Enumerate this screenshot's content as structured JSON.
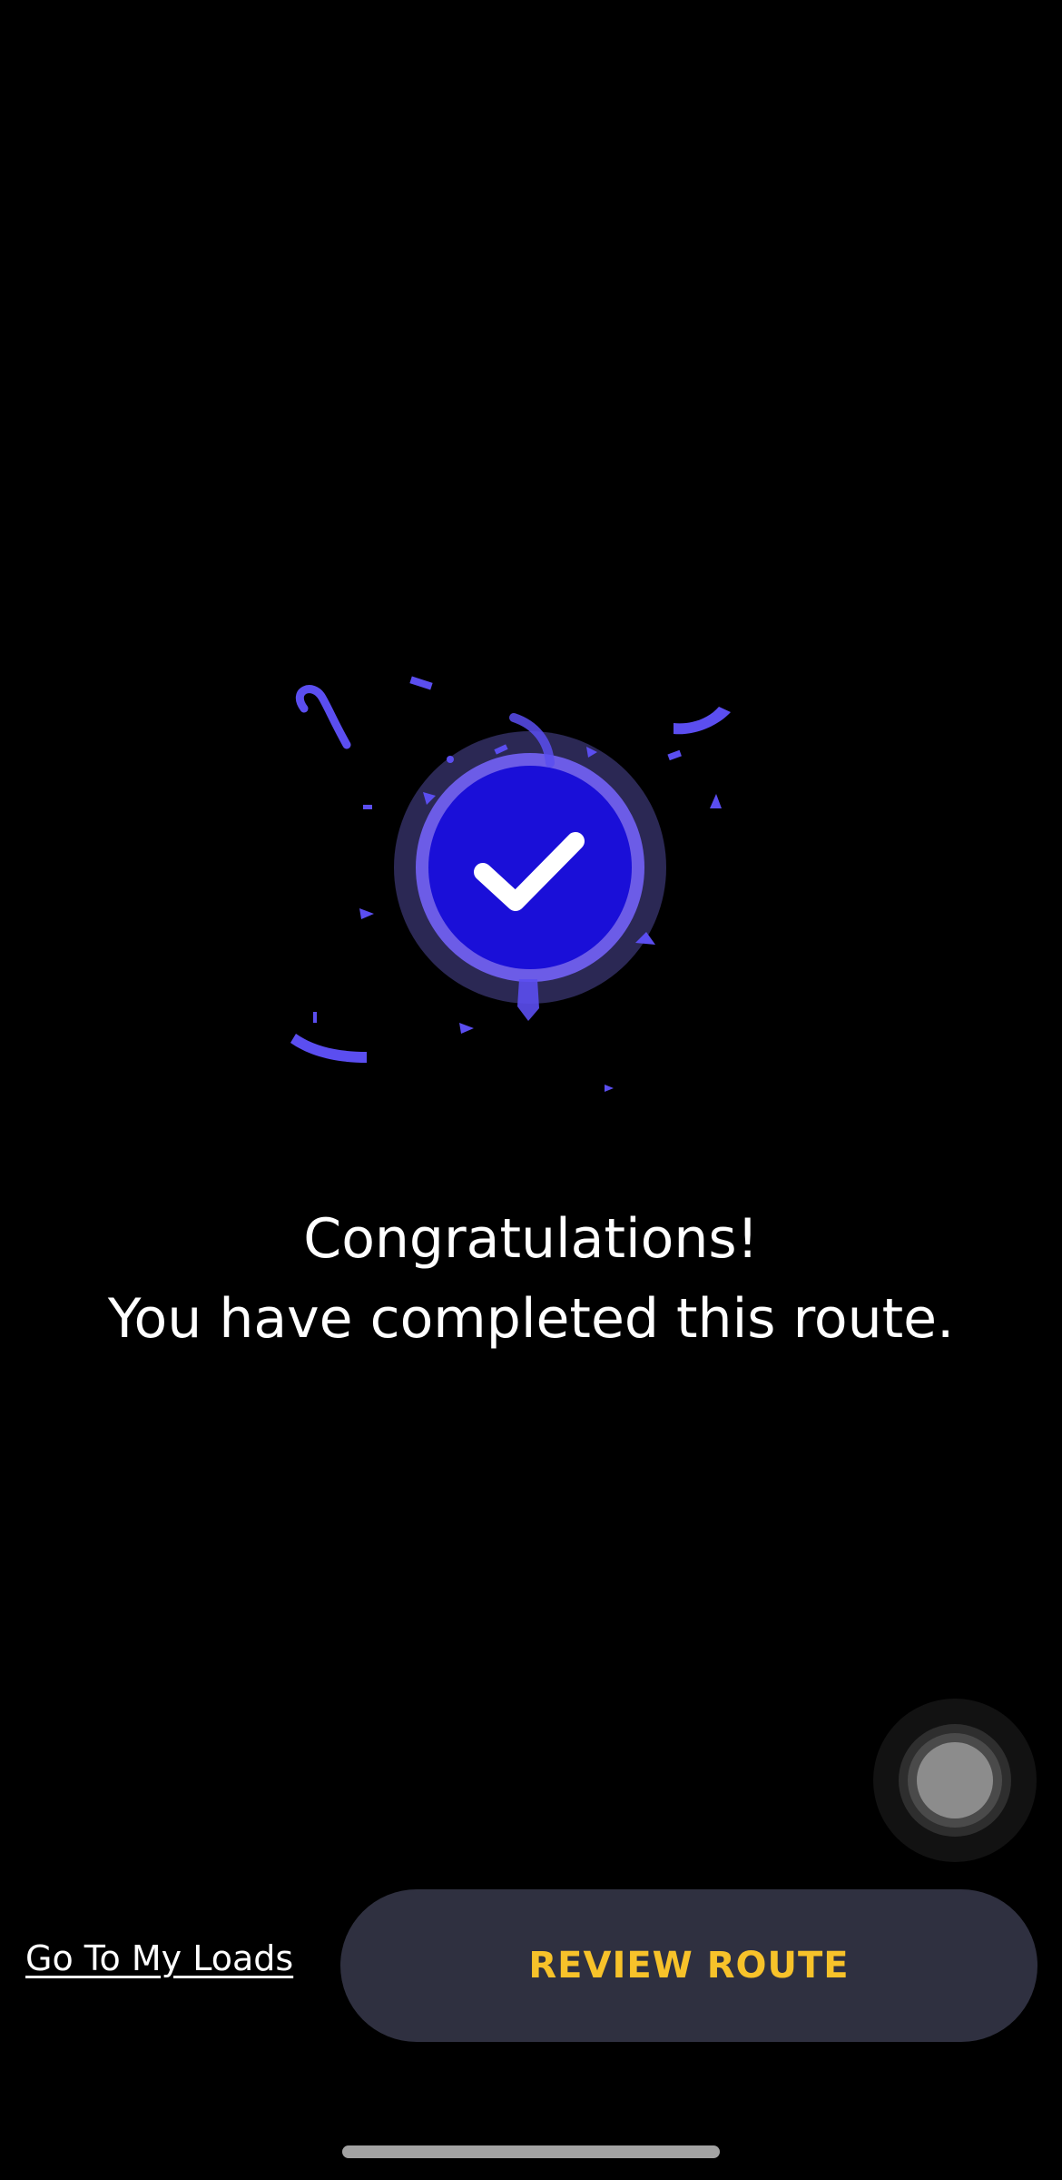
{
  "message": {
    "line1": "Congratulations!",
    "line2": "You have completed this route."
  },
  "actions": {
    "go_to_loads_label": "Go To My Loads",
    "review_route_label": "REVIEW ROUTE"
  },
  "icons": {
    "success": "check-icon",
    "assistive": "assistive-touch-icon"
  },
  "colors": {
    "background": "#000000",
    "badge_fill": "#1a0fd8",
    "badge_ring": "#6c5ce7",
    "confetti": "#5b4ef0",
    "button_bg": "#2f3040",
    "button_text": "#f7c22a",
    "text": "#ffffff"
  }
}
